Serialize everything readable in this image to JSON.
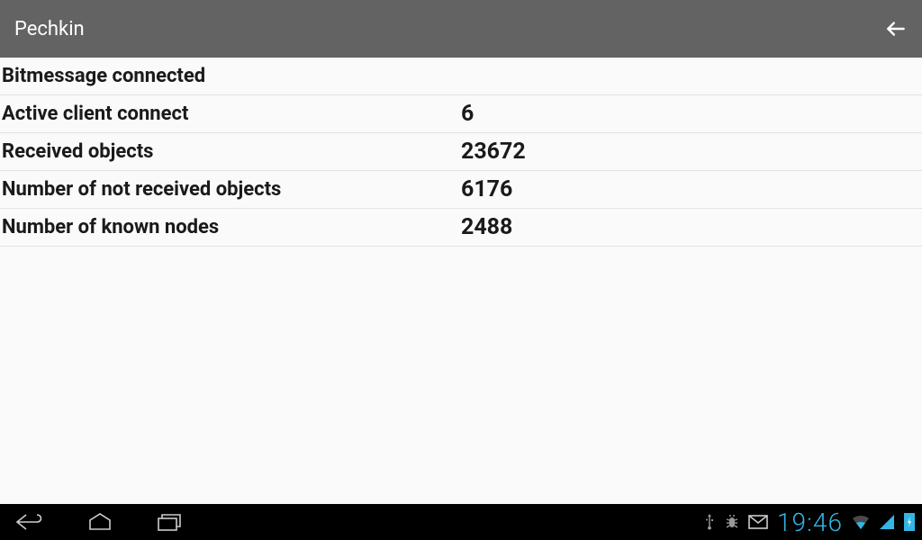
{
  "header": {
    "title": "Pechkin"
  },
  "status": {
    "connection_label": "Bitmessage connected",
    "rows": [
      {
        "label": "Active client connect",
        "value": "6"
      },
      {
        "label": "Received objects",
        "value": "23672"
      },
      {
        "label": "Number of not received objects",
        "value": "6176"
      },
      {
        "label": "Number of known nodes",
        "value": "2488"
      }
    ]
  },
  "navbar": {
    "time": "19:46"
  }
}
